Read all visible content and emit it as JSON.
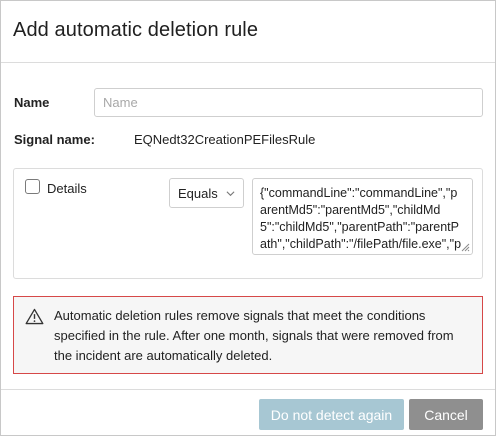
{
  "dialog": {
    "title": "Add automatic deletion rule"
  },
  "name_field": {
    "label": "Name",
    "value": "",
    "placeholder": "Name"
  },
  "signal": {
    "label": "Signal name:",
    "value": "EQNedt32CreationPEFilesRule"
  },
  "condition": {
    "checkbox_checked": false,
    "details_label": "Details",
    "operator": "Equals",
    "value_text": "{\"commandLine\":\"commandLine\",\"parentMd5\":\"parentMd5\",\"childMd5\":\"childMd5\",\"parentPath\":\"parentPath\",\"childPath\":\"/filePath/file.exe\",\"parentFilename\":\"parentF"
  },
  "warning": {
    "icon": "warning-triangle-icon",
    "text": "Automatic deletion rules remove signals that meet the conditions specified in the rule. After one month, signals that were removed from the incident are automatically deleted.",
    "border_color": "#d64848"
  },
  "footer": {
    "primary_label": "Do not detect again",
    "primary_color": "#a7c7d3",
    "secondary_label": "Cancel",
    "secondary_color": "#8f8f8f"
  }
}
